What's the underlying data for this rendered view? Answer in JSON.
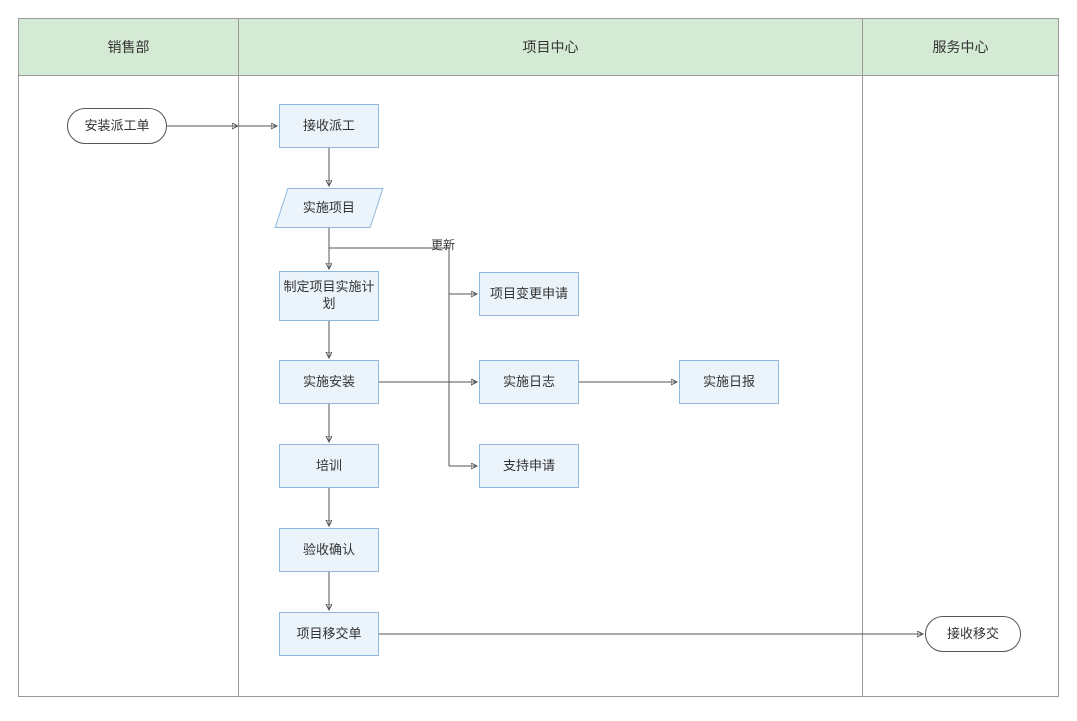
{
  "lanes": {
    "sales": "销售部",
    "project": "项目中心",
    "service": "服务中心"
  },
  "nodes": {
    "dispatch_order": "安装派工单",
    "receive_dispatch": "接收派工",
    "impl_project": "实施项目",
    "make_plan": "制定项目实施计划",
    "install": "实施安装",
    "training": "培训",
    "acceptance": "验收确认",
    "handover": "项目移交单",
    "change_request": "项目变更申请",
    "impl_log": "实施日志",
    "impl_daily": "实施日报",
    "support_request": "支持申请",
    "receive_handover": "接收移交"
  },
  "edges": {
    "update": "更新"
  }
}
